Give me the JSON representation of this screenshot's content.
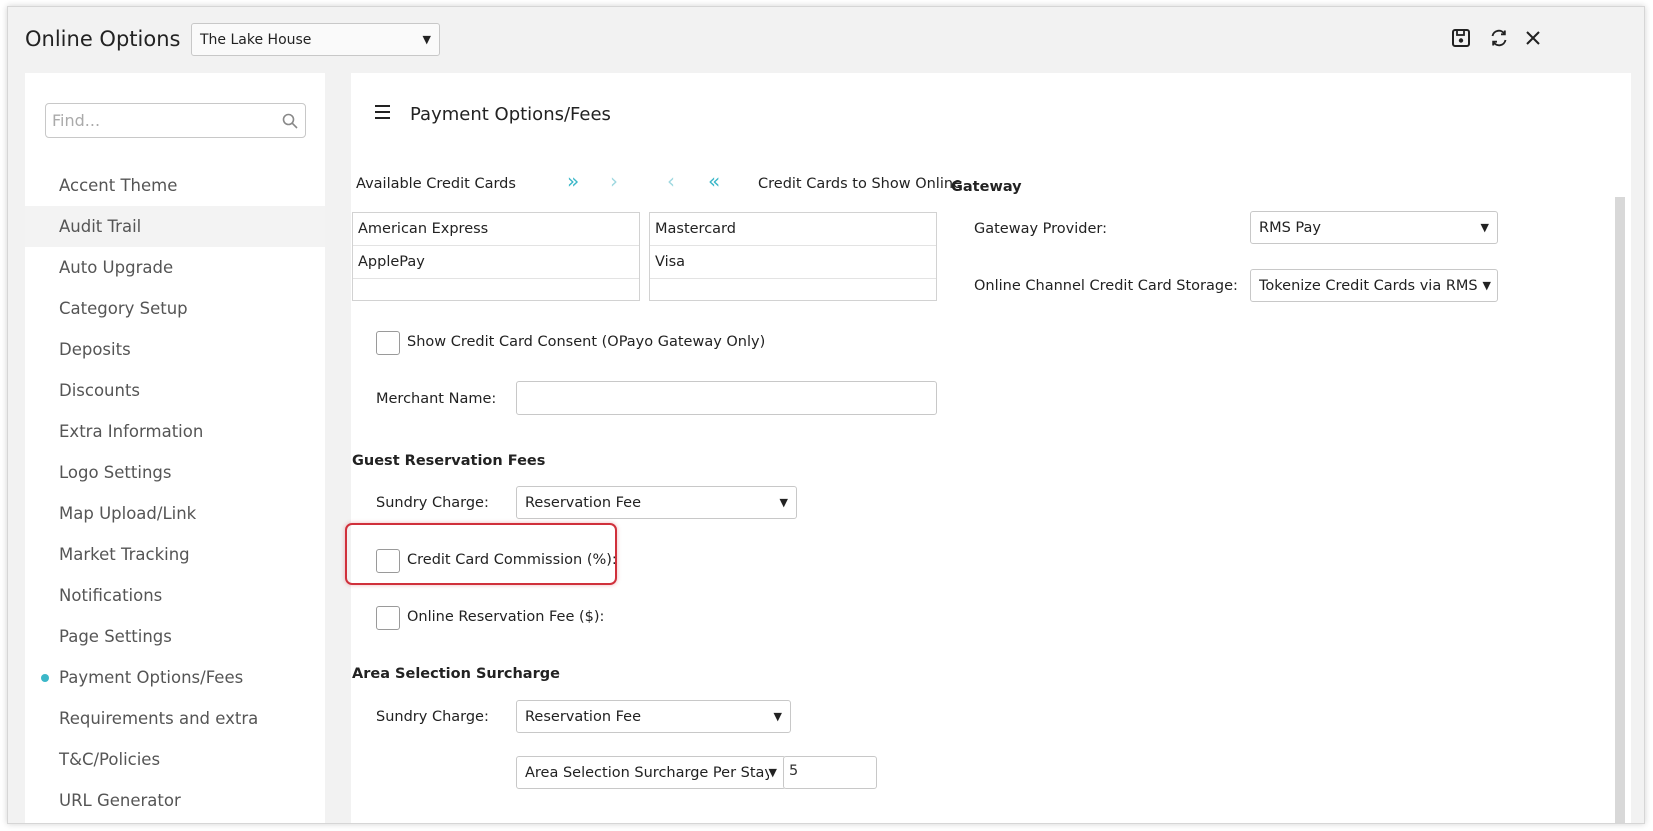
{
  "header": {
    "title": "Online Options",
    "property_select": "The Lake House"
  },
  "toolbar": {
    "save_icon": "save-icon",
    "refresh_icon": "refresh-icon",
    "close_icon": "close-icon"
  },
  "sidebar": {
    "find_placeholder": "Find...",
    "items": [
      {
        "label": "Accent Theme"
      },
      {
        "label": "Audit Trail"
      },
      {
        "label": "Auto Upgrade"
      },
      {
        "label": "Category Setup"
      },
      {
        "label": "Deposits"
      },
      {
        "label": "Discounts"
      },
      {
        "label": "Extra Information"
      },
      {
        "label": "Logo Settings"
      },
      {
        "label": "Map Upload/Link"
      },
      {
        "label": "Market Tracking"
      },
      {
        "label": "Notifications"
      },
      {
        "label": "Page Settings"
      },
      {
        "label": "Payment Options/Fees"
      },
      {
        "label": "Requirements and extra"
      },
      {
        "label": "T&C/Policies"
      },
      {
        "label": "URL Generator"
      }
    ],
    "active_item": "Payment Options/Fees",
    "accent_color": "#3bb7c8"
  },
  "main": {
    "section_title": "Payment Options/Fees",
    "available_cards_label": "Available Credit Cards",
    "show_online_label": "Credit Cards to Show Online",
    "available_cards": [
      "American Express",
      "ApplePay"
    ],
    "online_cards": [
      "Mastercard",
      "Visa"
    ],
    "consent_label": "Show Credit Card Consent (OPayo Gateway Only)",
    "merchant_name_label": "Merchant Name:",
    "merchant_name_value": "",
    "guest_fees_title": "Guest Reservation Fees",
    "sundry_charge_label": "Sundry Charge:",
    "sundry_charge_value": "Reservation Fee",
    "cc_commission_label": "Credit Card Commission (%):",
    "online_fee_label": "Online Reservation Fee ($):",
    "area_surcharge_title": "Area Selection Surcharge",
    "area_sundry_label": "Sundry Charge:",
    "area_sundry_value": "Reservation Fee",
    "area_surcharge_type": "Area Selection Surcharge Per Stay $",
    "area_surcharge_amount": "5"
  },
  "gateway": {
    "title": "Gateway",
    "provider_label": "Gateway Provider:",
    "provider_value": "RMS Pay",
    "storage_label": "Online Channel Credit Card Storage:",
    "storage_value": "Tokenize Credit Cards via RMS Pay"
  },
  "highlight_color": "#d0303b"
}
